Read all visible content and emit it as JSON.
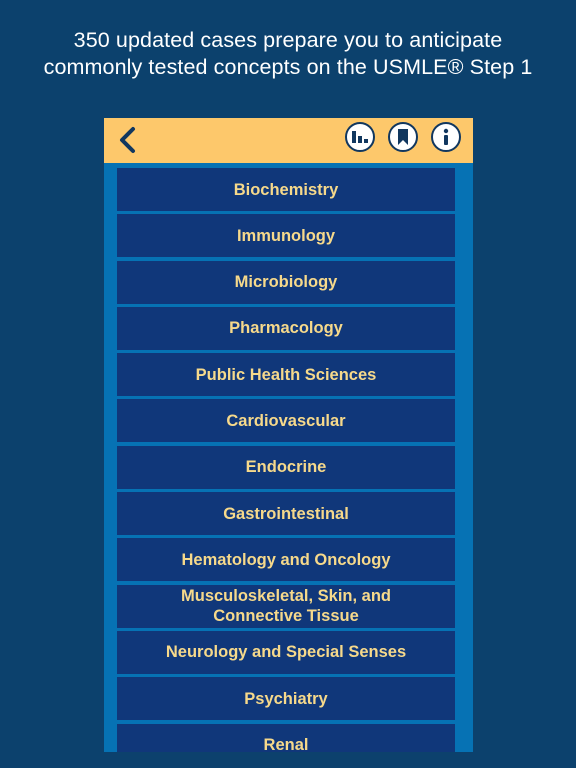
{
  "headline": {
    "line1": "350 updated cases prepare you to anticipate",
    "line2": "commonly tested concepts on the USMLE® Step 1"
  },
  "toolbar": {
    "back_icon": "chevron-left-icon",
    "buttons": [
      {
        "name": "stats",
        "icon": "bar-chart-icon"
      },
      {
        "name": "bookmarks",
        "icon": "bookmark-icon"
      },
      {
        "name": "info",
        "icon": "info-icon"
      }
    ]
  },
  "colors": {
    "background": "#0c416d",
    "toolbar": "#fdc86b",
    "list_background": "#0672b4",
    "item_background": "#10377a",
    "item_text": "#f6d98b",
    "icon_stroke": "#11375f"
  },
  "categories": [
    {
      "label": "Biochemistry"
    },
    {
      "label": "Immunology"
    },
    {
      "label": "Microbiology"
    },
    {
      "label": "Pharmacology"
    },
    {
      "label": "Public Health Sciences"
    },
    {
      "label": "Cardiovascular"
    },
    {
      "label": "Endocrine"
    },
    {
      "label": "Gastrointestinal"
    },
    {
      "label": "Hematology and Oncology"
    },
    {
      "label": "Musculoskeletal, Skin, and",
      "label2": "Connective Tissue"
    },
    {
      "label": "Neurology and Special Senses"
    },
    {
      "label": "Psychiatry"
    },
    {
      "label": "Renal"
    }
  ]
}
